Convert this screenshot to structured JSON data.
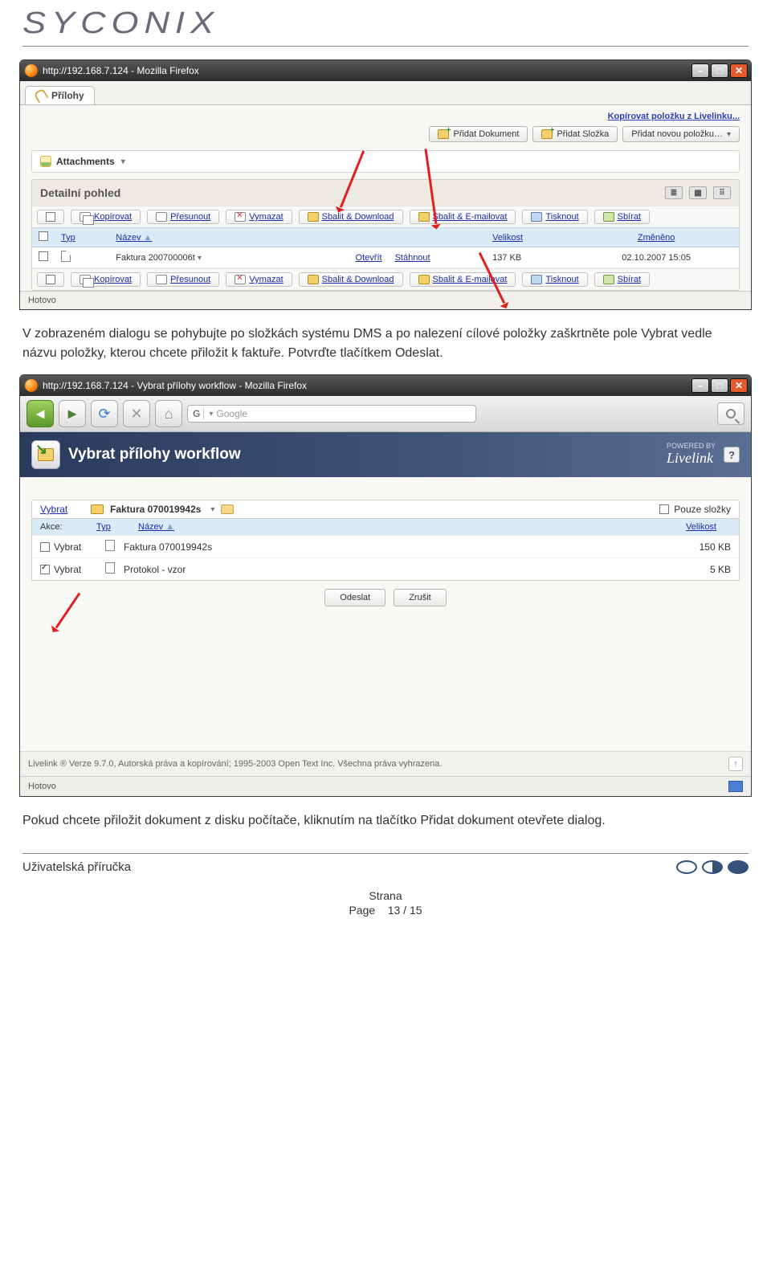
{
  "logo": "SYCONIX",
  "win1": {
    "title": "http://192.168.7.124 - Mozilla Firefox",
    "tab": "Přílohy",
    "link_copy": "Kopírovat položku z Livelinku...",
    "btn_add_doc": "Přidat Dokument",
    "btn_add_folder": "Přidat Složka",
    "btn_add_new": "Přidat novou položku…",
    "attachments": "Attachments",
    "detail": "Detailní pohled",
    "tools": {
      "copy": "Kopírovat",
      "move": "Přesunout",
      "del": "Vymazat",
      "pack_dl": "Sbalit & Download",
      "pack_mail": "Sbalit & E-mailovat",
      "print": "Tisknout",
      "collect": "Sbírat"
    },
    "cols": {
      "typ": "Typ",
      "nazev": "Název",
      "akce1": "Otevřít",
      "akce2": "Stáhnout",
      "velikost": "Velikost",
      "zmeneno": "Změněno"
    },
    "row": {
      "name": "Faktura 200700006t",
      "size": "137 KB",
      "date": "02.10.2007 15:05"
    },
    "status": "Hotovo"
  },
  "para1": "V zobrazeném dialogu se pohybujte po složkách systému DMS a po nalezení cílové položky zaškrtněte pole Vybrat vedle názvu položky, kterou chcete přiložit k faktuře. Potvrďte tlačítkem Odeslat.",
  "win2": {
    "title": "http://192.168.7.124 - Vybrat přílohy workflow - Mozilla Firefox",
    "search_engine": "G",
    "search_placeholder": "Google",
    "banner_title": "Vybrat přílohy workflow",
    "powered_small": "POWERED BY",
    "powered_big": "Livelink",
    "vybrat": "Vybrat",
    "folder_name": "Faktura 070019942s",
    "pouze": "Pouze složky",
    "hdr": {
      "akce": "Akce:",
      "typ": "Typ",
      "nazev": "Název",
      "velikost": "Velikost"
    },
    "rows": [
      {
        "selected": false,
        "name": "Faktura 070019942s",
        "size": "150 KB"
      },
      {
        "selected": true,
        "name": "Protokol - vzor",
        "size": "5 KB"
      }
    ],
    "btn_send": "Odeslat",
    "btn_cancel": "Zrušit",
    "footer_text": "Livelink ® Verze 9.7.0, Autorská práva a kopírování; 1995-2003 Open Text Inc. Všechna práva vyhrazena.",
    "status": "Hotovo"
  },
  "para2": "Pokud chcete přiložit dokument z disku počítače, kliknutím na tlačítko Přidat dokument otevřete dialog.",
  "footer": {
    "left": "Uživatelská příručka",
    "center_l1": "Strana",
    "center_l2": "Page",
    "page": "13 / 15"
  }
}
